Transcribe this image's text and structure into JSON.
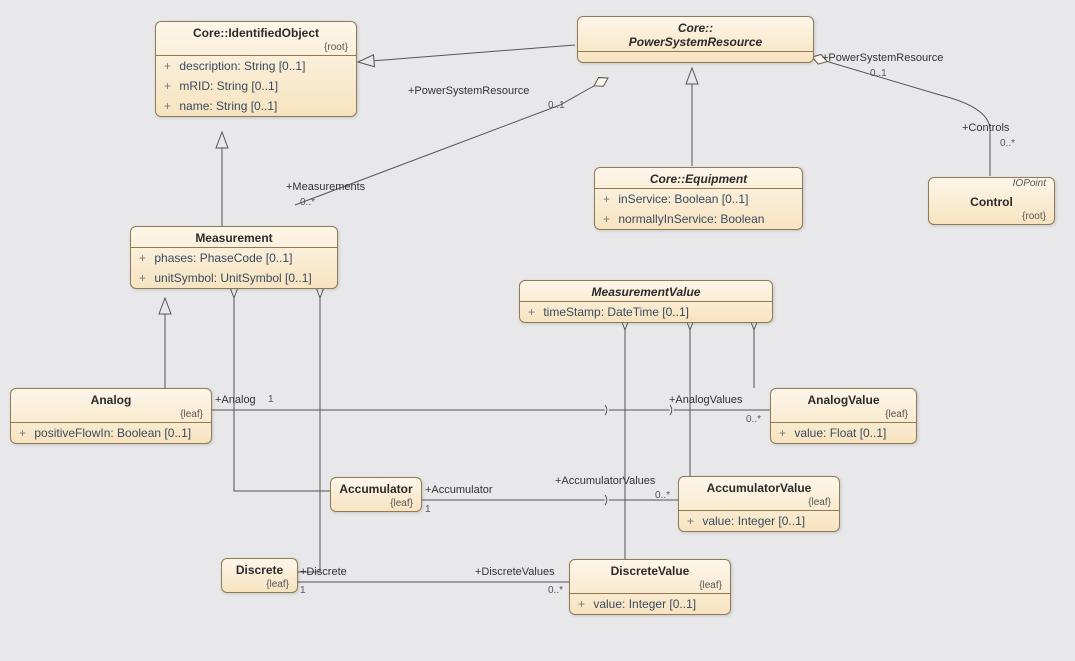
{
  "classes": {
    "identifiedObject": {
      "title": "Core::IdentifiedObject",
      "stereo": "{root}",
      "attrs": [
        "description: String [0..1]",
        "mRID: String [0..1]",
        "name: String [0..1]"
      ]
    },
    "powerSystemResource": {
      "title": "Core::\nPowerSystemResource",
      "stereo": ""
    },
    "equipment": {
      "title": "Core::Equipment",
      "stereo": "",
      "attrs": [
        "inService: Boolean [0..1]",
        "normallyInService: Boolean"
      ]
    },
    "control": {
      "title": "Control",
      "stereo": "{root}",
      "iopoint": "IOPoint"
    },
    "measurement": {
      "title": "Measurement",
      "stereo": "",
      "attrs": [
        "phases: PhaseCode [0..1]",
        "unitSymbol: UnitSymbol [0..1]"
      ]
    },
    "measurementValue": {
      "title": "MeasurementValue",
      "stereo": "",
      "attrs": [
        "timeStamp: DateTime [0..1]"
      ]
    },
    "analog": {
      "title": "Analog",
      "stereo": "{leaf}",
      "attrs": [
        "positiveFlowIn: Boolean [0..1]"
      ]
    },
    "accumulator": {
      "title": "Accumulator",
      "stereo": "{leaf}"
    },
    "discrete": {
      "title": "Discrete",
      "stereo": "{leaf}"
    },
    "analogValue": {
      "title": "AnalogValue",
      "stereo": "{leaf}",
      "attrs": [
        "value: Float [0..1]"
      ]
    },
    "accumulatorValue": {
      "title": "AccumulatorValue",
      "stereo": "{leaf}",
      "attrs": [
        "value: Integer [0..1]"
      ]
    },
    "discreteValue": {
      "title": "DiscreteValue",
      "stereo": "{leaf}",
      "attrs": [
        "value: Integer [0..1]"
      ]
    }
  },
  "labels": {
    "psr_left_role": "+PowerSystemResource",
    "psr_left_mult": "0..1",
    "psr_right_role": "+PowerSystemResource",
    "psr_right_mult": "0..1",
    "controls_role": "+Controls",
    "controls_mult": "0..*",
    "measurements_role": "+Measurements",
    "measurements_mult": "0..*",
    "analog_role": "+Analog",
    "analog_mult": "1",
    "analogValues_role": "+AnalogValues",
    "analogValues_mult": "0..*",
    "accumulator_role": "+Accumulator",
    "accumulator_mult": "1",
    "accumulatorValues_role": "+AccumulatorValues",
    "accumulatorValues_mult": "0..*",
    "discrete_role": "+Discrete",
    "discrete_mult": "1",
    "discreteValues_role": "+DiscreteValues",
    "discreteValues_mult": "0..*"
  }
}
